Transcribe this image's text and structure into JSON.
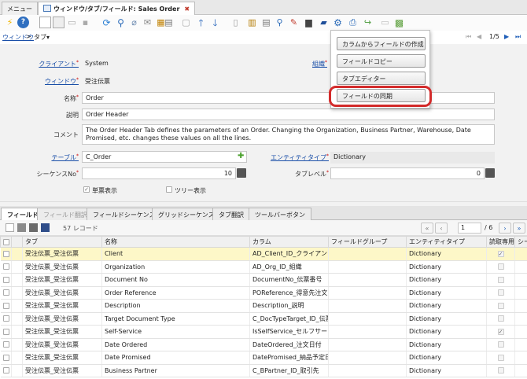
{
  "window_tabs": [
    {
      "label": "メニュー"
    },
    {
      "label": "ウィンドウ/タブ/フィールド: Sales Order"
    }
  ],
  "breadcrumb": {
    "root": "ウィンドウ",
    "sep": ">",
    "current": "タブ▾"
  },
  "record_nav": {
    "position": "1/5",
    "first": "⏮",
    "prev": "◀",
    "next": "▶",
    "last": "⏭"
  },
  "form": {
    "client_label": "クライアント",
    "client_value": "System",
    "org_label": "組織",
    "window_label": "ウィンドウ",
    "window_value": "受注伝票",
    "name_label": "名称",
    "name_value": "Order",
    "desc_label": "説明",
    "desc_value": "Order Header",
    "comment_label": "コメント",
    "comment_value": "The Order Header Tab defines the parameters of an Order. Changing the Organization, Business Partner, Warehouse, Date Promised, etc. changes these values on all the lines.",
    "table_label": "テーブル",
    "table_value": "C_Order",
    "entity_label": "エンティティタイプ",
    "entity_value": "Dictionary",
    "seq_label": "シーケンスNo",
    "seq_value": "10",
    "tablevel_label": "タブレベル",
    "tablevel_value": "0",
    "single_row_label": "単票表示",
    "single_row_checked": true,
    "tree_label": "ツリー表示",
    "tree_checked": false
  },
  "context_menu": {
    "items": [
      "カラムからフィールドの作成",
      "フィールドコピー",
      "タブエディター",
      "フィールドの同期"
    ],
    "highlighted_index": 3,
    "highlight_color": "#d32b2b"
  },
  "detail_tabs": [
    {
      "label": "フィールド",
      "active": true
    },
    {
      "label": "フィールド翻訳",
      "disabled": true
    },
    {
      "label": "フィールドシーケンス"
    },
    {
      "label": "グリッドシーケンス"
    },
    {
      "label": "タブ翻訳"
    },
    {
      "label": "ツールバーボタン"
    }
  ],
  "grid_toolbar": {
    "record_count": "57 レコード",
    "page_input": "1",
    "page_total": "/ 6"
  },
  "grid": {
    "columns": [
      "タブ",
      "名称",
      "カラム",
      "フィールドグループ",
      "エンティティタイプ",
      "読取専用",
      "シー"
    ],
    "rows": [
      {
        "tab": "受注伝票_受注伝票",
        "name": "Client",
        "column": "AD_Client_ID_クライアント",
        "group": "",
        "entity": "Dictionary",
        "readonly": true
      },
      {
        "tab": "受注伝票_受注伝票",
        "name": "Organization",
        "column": "AD_Org_ID_組織",
        "group": "",
        "entity": "Dictionary",
        "readonly": false
      },
      {
        "tab": "受注伝票_受注伝票",
        "name": "Document No",
        "column": "DocumentNo_伝票番号",
        "group": "",
        "entity": "Dictionary",
        "readonly": false
      },
      {
        "tab": "受注伝票_受注伝票",
        "name": "Order Reference",
        "column": "POReference_得意先注文",
        "group": "",
        "entity": "Dictionary",
        "readonly": false
      },
      {
        "tab": "受注伝票_受注伝票",
        "name": "Description",
        "column": "Description_説明",
        "group": "",
        "entity": "Dictionary",
        "readonly": false
      },
      {
        "tab": "受注伝票_受注伝票",
        "name": "Target Document Type",
        "column": "C_DocTypeTarget_ID_伝票…",
        "group": "",
        "entity": "Dictionary",
        "readonly": false
      },
      {
        "tab": "受注伝票_受注伝票",
        "name": "Self-Service",
        "column": "IsSelfService_セルフサービス",
        "group": "",
        "entity": "Dictionary",
        "readonly": true
      },
      {
        "tab": "受注伝票_受注伝票",
        "name": "Date Ordered",
        "column": "DateOrdered_注文日付",
        "group": "",
        "entity": "Dictionary",
        "readonly": false
      },
      {
        "tab": "受注伝票_受注伝票",
        "name": "Date Promised",
        "column": "DatePromised_納品予定日",
        "group": "",
        "entity": "Dictionary",
        "readonly": false
      },
      {
        "tab": "受注伝票_受注伝票",
        "name": "Business Partner",
        "column": "C_BPartner_ID_取引先",
        "group": "",
        "entity": "Dictionary",
        "readonly": false
      }
    ]
  },
  "colors": {
    "link": "#1a4fa8",
    "selected_row": "#fdf7c8",
    "form_bg": "#f2f2f2"
  }
}
